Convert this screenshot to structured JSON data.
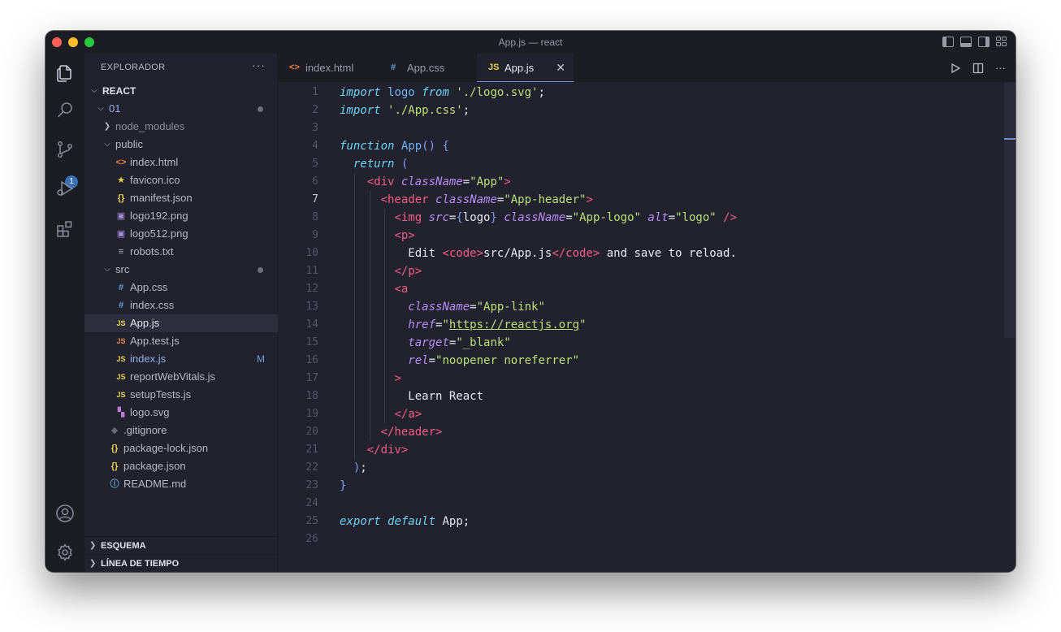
{
  "window": {
    "title": "App.js — react"
  },
  "activity_bar": {
    "source_control_badge": "1",
    "items": [
      "explorer-icon",
      "search-icon",
      "source-control-icon",
      "run-debug-icon",
      "extensions-icon",
      "account-icon",
      "settings-icon"
    ]
  },
  "sidebar": {
    "title": "EXPLORADOR",
    "more": "···",
    "tree": [
      {
        "label": "REACT",
        "depth": 0,
        "chevron": "down",
        "bold": true
      },
      {
        "label": "01",
        "depth": 1,
        "chevron": "down",
        "dot": true,
        "color": "#8fb0ea"
      },
      {
        "label": "node_modules",
        "depth": 2,
        "chevron": "right",
        "color": "#8e8e9c"
      },
      {
        "label": "public",
        "depth": 2,
        "chevron": "down"
      },
      {
        "label": "index.html",
        "depth": 3,
        "icon": "<>",
        "icon_color": "#e8863a"
      },
      {
        "label": "favicon.ico",
        "depth": 3,
        "icon": "★",
        "icon_color": "#e8d44d"
      },
      {
        "label": "manifest.json",
        "depth": 3,
        "icon": "{}",
        "icon_color": "#e8d44d"
      },
      {
        "label": "logo192.png",
        "depth": 3,
        "icon": "▣",
        "icon_color": "#a58bd9"
      },
      {
        "label": "logo512.png",
        "depth": 3,
        "icon": "▣",
        "icon_color": "#a58bd9"
      },
      {
        "label": "robots.txt",
        "depth": 3,
        "icon": "≡",
        "icon_color": "#b9b9c6"
      },
      {
        "label": "src",
        "depth": 2,
        "chevron": "down",
        "dot": true
      },
      {
        "label": "App.css",
        "depth": 3,
        "icon": "#",
        "icon_color": "#5fa8d8"
      },
      {
        "label": "index.css",
        "depth": 3,
        "icon": "#",
        "icon_color": "#5fa8d8"
      },
      {
        "label": "App.js",
        "depth": 3,
        "icon": "JS",
        "icon_color": "#e8d44d",
        "active": true,
        "color": "#e8e8f2"
      },
      {
        "label": "App.test.js",
        "depth": 3,
        "icon": "JS",
        "icon_color": "#e8863a"
      },
      {
        "label": "index.js",
        "depth": 3,
        "icon": "JS",
        "icon_color": "#e8d44d",
        "modified": "M",
        "color": "#8fb0ea"
      },
      {
        "label": "reportWebVitals.js",
        "depth": 3,
        "icon": "JS",
        "icon_color": "#e8d44d"
      },
      {
        "label": "setupTests.js",
        "depth": 3,
        "icon": "JS",
        "icon_color": "#e8d44d"
      },
      {
        "label": "logo.svg",
        "depth": 3,
        "icon": "▚",
        "icon_color": "#c07ad9"
      },
      {
        "label": ".gitignore",
        "depth": 2,
        "icon": "◆",
        "icon_color": "#5e6b7a"
      },
      {
        "label": "package-lock.json",
        "depth": 2,
        "icon": "{}",
        "icon_color": "#e8d44d"
      },
      {
        "label": "package.json",
        "depth": 2,
        "icon": "{}",
        "icon_color": "#e8d44d"
      },
      {
        "label": "README.md",
        "depth": 2,
        "icon": "ⓘ",
        "icon_color": "#5fa8d8"
      }
    ],
    "sections": [
      "ESQUEMA",
      "LÍNEA DE TIEMPO"
    ]
  },
  "tabs": [
    {
      "label": "index.html",
      "icon": "<>",
      "icon_color": "#e8863a",
      "active": false
    },
    {
      "label": "App.css",
      "icon": "#",
      "icon_color": "#5fa8d8",
      "active": false
    },
    {
      "label": "App.js",
      "icon": "JS",
      "icon_color": "#e8d44d",
      "active": true,
      "close": "✕"
    }
  ],
  "editor": {
    "current_line": 7,
    "lines": [
      [
        [
          "kw",
          "import"
        ],
        [
          "txt",
          " "
        ],
        [
          "fn",
          "logo"
        ],
        [
          "txt",
          " "
        ],
        [
          "kw",
          "from"
        ],
        [
          "txt",
          " "
        ],
        [
          "str",
          "'./logo.svg'"
        ],
        [
          "punc",
          ";"
        ]
      ],
      [
        [
          "kw",
          "import"
        ],
        [
          "txt",
          " "
        ],
        [
          "str",
          "'./App.css'"
        ],
        [
          "punc",
          ";"
        ]
      ],
      [],
      [
        [
          "kw",
          "function"
        ],
        [
          "txt",
          " "
        ],
        [
          "fn",
          "App"
        ],
        [
          "brk",
          "()"
        ],
        [
          "txt",
          " "
        ],
        [
          "brk",
          "{"
        ]
      ],
      [
        [
          "txt",
          "  "
        ],
        [
          "kw",
          "return"
        ],
        [
          "txt",
          " "
        ],
        [
          "brk",
          "("
        ]
      ],
      [
        [
          "txt",
          "    "
        ],
        [
          "tag",
          "<div"
        ],
        [
          "txt",
          " "
        ],
        [
          "attr",
          "className"
        ],
        [
          "punc",
          "="
        ],
        [
          "str",
          "\"App\""
        ],
        [
          "tag",
          ">"
        ]
      ],
      [
        [
          "txt",
          "      "
        ],
        [
          "tag",
          "<header"
        ],
        [
          "txt",
          " "
        ],
        [
          "attr",
          "className"
        ],
        [
          "punc",
          "="
        ],
        [
          "str",
          "\"App-header\""
        ],
        [
          "tag",
          ">"
        ]
      ],
      [
        [
          "txt",
          "        "
        ],
        [
          "tag",
          "<img"
        ],
        [
          "txt",
          " "
        ],
        [
          "attr",
          "src"
        ],
        [
          "punc",
          "="
        ],
        [
          "brk",
          "{"
        ],
        [
          "txt",
          "logo"
        ],
        [
          "brk",
          "}"
        ],
        [
          "txt",
          " "
        ],
        [
          "attr",
          "className"
        ],
        [
          "punc",
          "="
        ],
        [
          "str",
          "\"App-logo\""
        ],
        [
          "txt",
          " "
        ],
        [
          "attr",
          "alt"
        ],
        [
          "punc",
          "="
        ],
        [
          "str",
          "\"logo\""
        ],
        [
          "txt",
          " "
        ],
        [
          "tag",
          "/>"
        ]
      ],
      [
        [
          "txt",
          "        "
        ],
        [
          "tag",
          "<p>"
        ]
      ],
      [
        [
          "txt",
          "          Edit "
        ],
        [
          "tag",
          "<code>"
        ],
        [
          "txt",
          "src/App.js"
        ],
        [
          "tag",
          "</code>"
        ],
        [
          "txt",
          " and save to reload."
        ]
      ],
      [
        [
          "txt",
          "        "
        ],
        [
          "tag",
          "</p>"
        ]
      ],
      [
        [
          "txt",
          "        "
        ],
        [
          "tag",
          "<a"
        ]
      ],
      [
        [
          "txt",
          "          "
        ],
        [
          "attr",
          "className"
        ],
        [
          "punc",
          "="
        ],
        [
          "str",
          "\"App-link\""
        ]
      ],
      [
        [
          "txt",
          "          "
        ],
        [
          "attr",
          "href"
        ],
        [
          "punc",
          "="
        ],
        [
          "str",
          "\""
        ],
        [
          "url",
          "https://reactjs.org"
        ],
        [
          "str",
          "\""
        ]
      ],
      [
        [
          "txt",
          "          "
        ],
        [
          "attr",
          "target"
        ],
        [
          "punc",
          "="
        ],
        [
          "str",
          "\"_blank\""
        ]
      ],
      [
        [
          "txt",
          "          "
        ],
        [
          "attr",
          "rel"
        ],
        [
          "punc",
          "="
        ],
        [
          "str",
          "\"noopener noreferrer\""
        ]
      ],
      [
        [
          "txt",
          "        "
        ],
        [
          "tag",
          ">"
        ]
      ],
      [
        [
          "txt",
          "          Learn React"
        ]
      ],
      [
        [
          "txt",
          "        "
        ],
        [
          "tag",
          "</a>"
        ]
      ],
      [
        [
          "txt",
          "      "
        ],
        [
          "tag",
          "</header>"
        ]
      ],
      [
        [
          "txt",
          "    "
        ],
        [
          "tag",
          "</div>"
        ]
      ],
      [
        [
          "txt",
          "  "
        ],
        [
          "brk",
          ")"
        ],
        [
          "punc",
          ";"
        ]
      ],
      [
        [
          "brk",
          "}"
        ]
      ],
      [],
      [
        [
          "kw",
          "export"
        ],
        [
          "txt",
          " "
        ],
        [
          "kw",
          "default"
        ],
        [
          "txt",
          " App;"
        ]
      ],
      []
    ]
  }
}
